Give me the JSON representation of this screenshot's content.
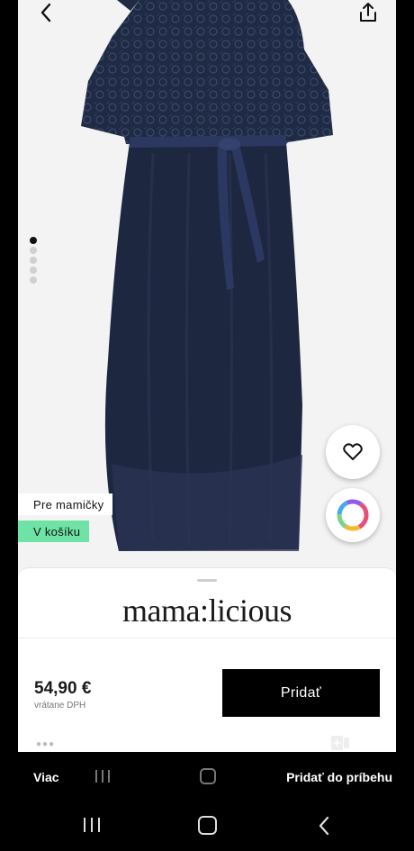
{
  "product": {
    "badges": {
      "for_moms": "Pre mamičky",
      "in_cart": "V košíku"
    },
    "image_indicator": {
      "count": 5,
      "active": 1
    },
    "brand": "mama:licious",
    "price": "54,90 €",
    "vat_note": "vrátane DPH",
    "add_button": "Pridať"
  },
  "story_bar": {
    "left_label": "Viac",
    "right_label": "Pridať do príbehu"
  },
  "icons": {
    "back": "chevron-left-icon",
    "share": "share-icon",
    "favorite": "heart-icon",
    "color_picker": "color-ring-icon",
    "story_add": "add-to-story-icon"
  },
  "colors": {
    "dress": "#1f2a44",
    "cart_badge": "#6fe3a6",
    "button": "#000000"
  }
}
